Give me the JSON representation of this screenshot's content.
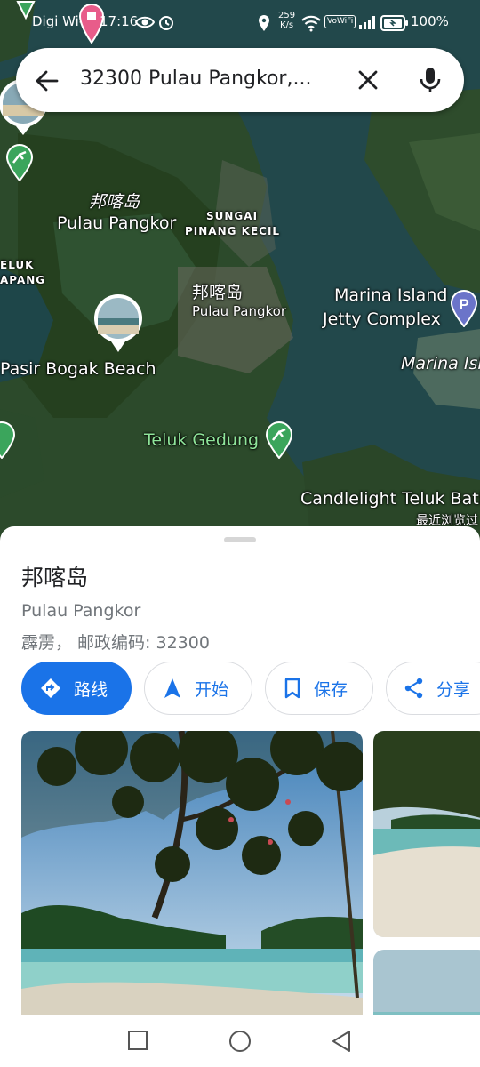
{
  "status_bar": {
    "carrier": "Digi Wi-Fi",
    "time": "17:16",
    "net_speed_value": "259",
    "net_speed_unit": "K/s",
    "vowifi": "VoWiFi",
    "battery": "100%"
  },
  "search": {
    "query": "32300 Pulau Pangkor,..."
  },
  "map": {
    "labels": {
      "pangkor_cn_1": "邦喀岛",
      "pangkor_1": "Pulau Pangkor",
      "sungai_1": "SUNGAI",
      "sungai_2": "PINANG KECIL",
      "teluk_1": "ELUK",
      "teluk_2": "APANG",
      "pangkor_cn_2": "邦喀岛",
      "pangkor_2": "Pulau Pangkor",
      "marina_1": "Marina Island",
      "marina_2": "Jetty Complex",
      "marina_partial": "Marina Isl",
      "pasir": "Pasir Bogak Beach",
      "teluk_gedung": "Teluk Gedung",
      "candlelight": "Candlelight Teluk Bati",
      "recent": "最近浏览过"
    },
    "colors": {
      "water": "#1f4a4e",
      "land": "#2d4a2a",
      "parking": "#6b74c9",
      "attraction": "#3ba55c"
    }
  },
  "place": {
    "title": "邦喀岛",
    "subtitle": "Pulau Pangkor",
    "address": "霹雳， 邮政编码: 32300"
  },
  "actions": {
    "directions": "路线",
    "start": "开始",
    "save": "保存",
    "share": "分享"
  },
  "accent": "#1a73e8"
}
